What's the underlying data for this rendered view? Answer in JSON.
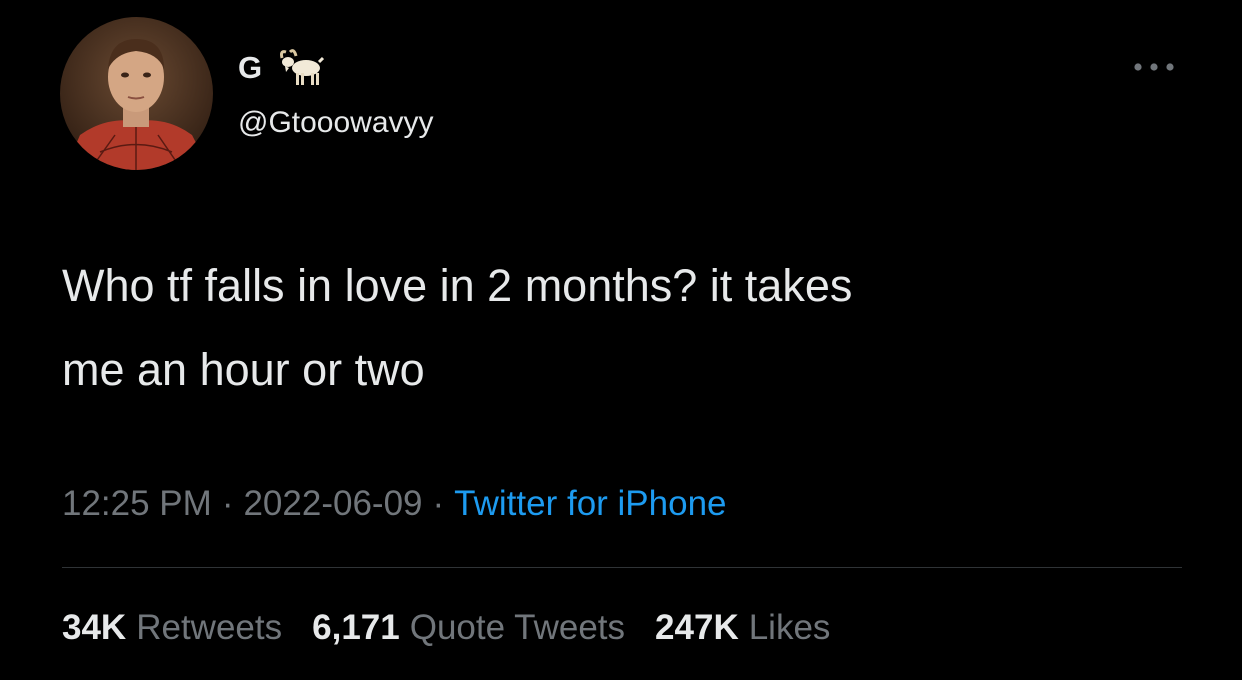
{
  "author": {
    "display_name": "G",
    "name_emoji": "goat-emoji",
    "handle": "@Gtooowavyy",
    "avatar_icon": "user-avatar-photo"
  },
  "tweet": {
    "text": "Who tf falls in love in 2 months? it takes\nme an hour or two",
    "time": "12:25 PM",
    "separator": "·",
    "date": "2022-06-09",
    "source": "Twitter for iPhone"
  },
  "stats": {
    "retweets_count": "34K",
    "retweets_label": "Retweets",
    "quotes_count": "6,171",
    "quotes_label": "Quote Tweets",
    "likes_count": "247K",
    "likes_label": "Likes"
  },
  "colors": {
    "background": "#000000",
    "text_primary": "#e7e9ea",
    "text_secondary": "#71767b",
    "link": "#1d9bf0",
    "divider": "#2f3336"
  }
}
